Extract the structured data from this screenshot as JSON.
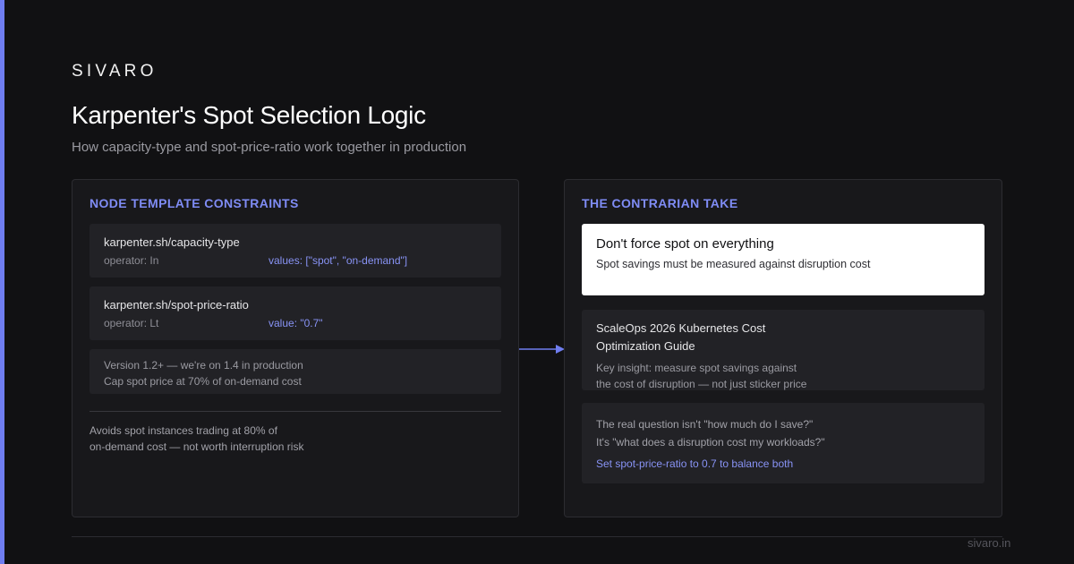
{
  "brand": {
    "name": "SIVARO",
    "site": "sivaro.in",
    "accent_color": "#6f7df0"
  },
  "header": {
    "title": "Karpenter's Spot Selection Logic",
    "subtitle": "How capacity-type and spot-price-ratio work together in production"
  },
  "left_panel": {
    "heading": "NODE TEMPLATE CONSTRAINTS",
    "constraints": [
      {
        "key": "karpenter.sh/capacity-type",
        "operator": "operator: In",
        "value": "values: [\"spot\", \"on-demand\"]"
      },
      {
        "key": "karpenter.sh/spot-price-ratio",
        "operator": "operator: Lt",
        "value": "value: \"0.7\""
      }
    ],
    "version_note": {
      "line1": "Version 1.2+ — we're on 1.4 in production",
      "line2": "Cap spot price at 70% of on-demand cost"
    },
    "footnote": {
      "line1": "Avoids spot instances trading at 80% of",
      "line2": "on-demand cost — not worth interruption risk"
    }
  },
  "right_panel": {
    "heading": "THE CONTRARIAN TAKE",
    "highlight": {
      "title": "Don't force spot on everything",
      "subtitle": "Spot savings must be measured against disruption cost"
    },
    "source": {
      "title_line1": "ScaleOps 2026 Kubernetes Cost",
      "title_line2": "Optimization Guide",
      "insight_line1": "Key insight: measure spot savings against",
      "insight_line2": "the cost of disruption — not just sticker price"
    },
    "question": {
      "line1": "The real question isn't \"how much do I save?\"",
      "line2": "It's \"what does a disruption cost my workloads?\"",
      "action": "Set spot-price-ratio to 0.7 to balance both"
    }
  },
  "colors": {
    "heading": "#7f8cf5",
    "value": "#8893f5",
    "background": "#111113"
  },
  "icons": {
    "connector": "arrow-right-icon"
  }
}
